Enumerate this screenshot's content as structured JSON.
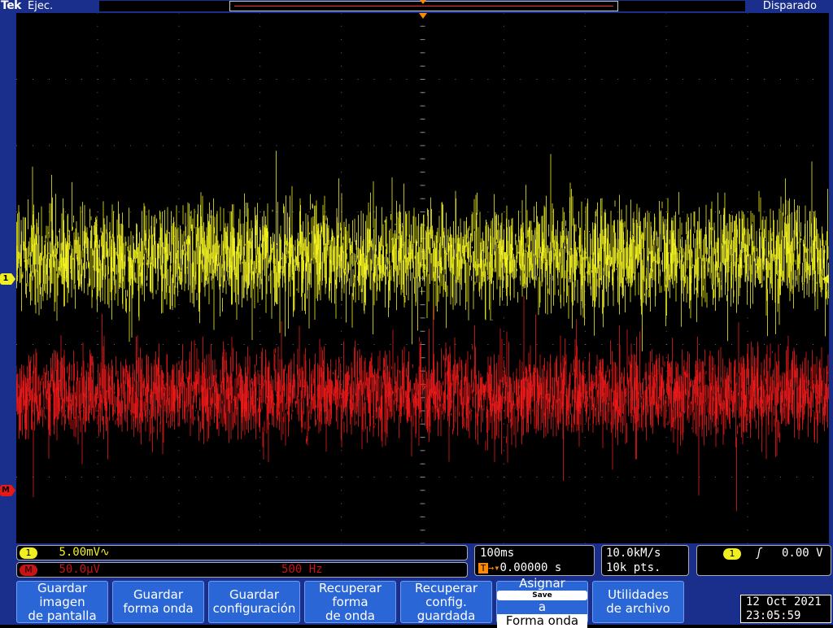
{
  "header": {
    "brand": "Tek",
    "mode": "Ejec.",
    "trigger_state": "Disparado"
  },
  "channel1": {
    "badge": "1",
    "scale": "5.00mV",
    "coupling_symbol": "∿",
    "color": "#f0f020"
  },
  "math": {
    "badge": "M",
    "scale": "50.0μV",
    "frequency": "500 Hz",
    "color": "#e81818"
  },
  "timebase": {
    "scale": "100ms",
    "trigger_icon": "T",
    "arrow": "→▾",
    "position": "0.00000 s"
  },
  "acquisition": {
    "sample_rate": "10.0kM/s",
    "record_length": "10k pts."
  },
  "trigger": {
    "source_badge": "1",
    "slope_symbol": "ʃ",
    "level": "0.00 V"
  },
  "menu": {
    "save_screen_image": [
      "Guardar",
      "imagen",
      "de pantalla"
    ],
    "save_waveform": [
      "Guardar",
      "forma onda"
    ],
    "save_setup": [
      "Guardar",
      "configuración"
    ],
    "recall_waveform": [
      "Recuperar",
      "forma",
      "de onda"
    ],
    "recall_setup": [
      "Recuperar",
      "config.",
      "guardada"
    ],
    "assign_save": {
      "line1": "Asignar",
      "badge": "Save",
      "connector": "a",
      "line3": "Forma onda"
    },
    "file_utilities": [
      "Utilidades",
      "de archivo"
    ]
  },
  "datetime": {
    "date": "12 Oct  2021",
    "time": "23:05:59"
  },
  "colors": {
    "bezel": "#1a2f8c",
    "button": "#2b66d6",
    "ch1_trace": "#f0f020",
    "math_trace": "#e81818"
  }
}
